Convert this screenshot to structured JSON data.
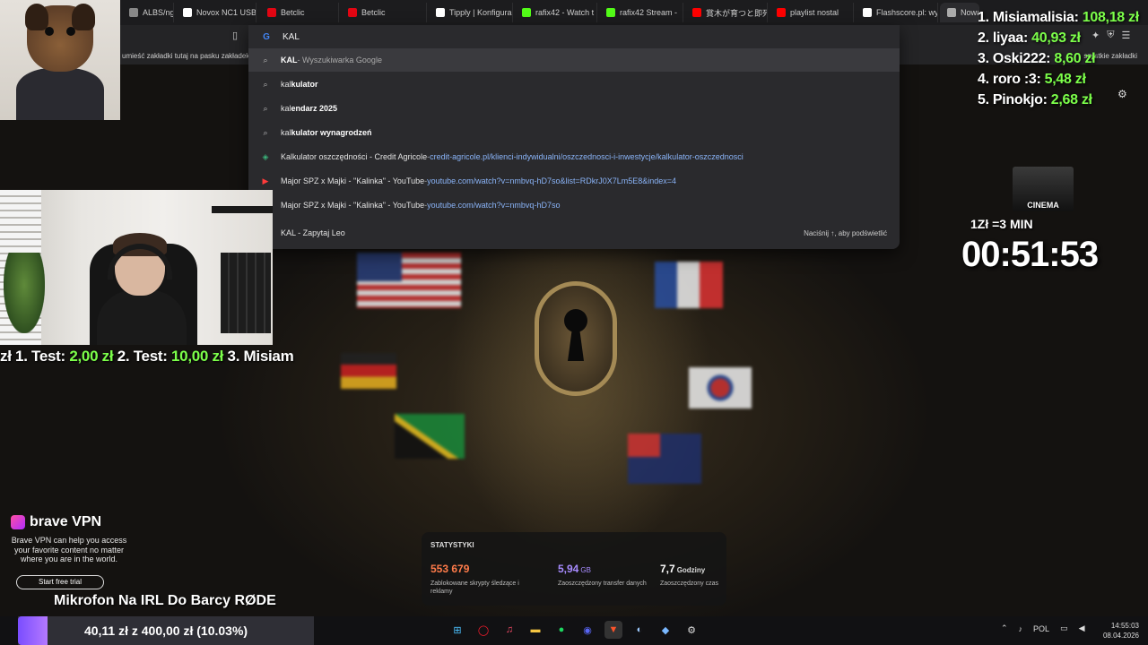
{
  "browser": {
    "tabs": [
      {
        "label": "ALBS/nginx-c",
        "color": "#888888"
      },
      {
        "label": "Novox NC1 USB",
        "color": "#ffffff"
      },
      {
        "label": "Betclic",
        "color": "#e30613"
      },
      {
        "label": "Betclic",
        "color": "#e30613"
      },
      {
        "label": "Tipply | Konfigura",
        "color": "#ffffff"
      },
      {
        "label": "rafix42 - Watch t",
        "color": "#53fc18"
      },
      {
        "label": "rafix42 Stream -",
        "color": "#53fc18"
      },
      {
        "label": "賞木が育つと即死",
        "color": "#ff0000"
      },
      {
        "label": "playlist nostal",
        "color": "#ff0000"
      },
      {
        "label": "Flashscore.pl: wyn",
        "color": "#ffffff"
      },
      {
        "label": "Nowa karta",
        "color": "#aaaaaa"
      }
    ],
    "address_value": "KAL",
    "bookmarks_hint": "umieść zakładki tutaj na pasku zakładek",
    "bookmarks_right": "szystkie zakładki"
  },
  "omnibox": {
    "suggestions": [
      {
        "icon": "search-icon",
        "bold": "KAL",
        "rest": " - Wyszukiwarka Google",
        "url": "",
        "dim": true
      },
      {
        "icon": "search-icon",
        "bold": "",
        "pre": "kal",
        "rest": "kulator",
        "url": ""
      },
      {
        "icon": "search-icon",
        "pre": "kal",
        "rest": "endarz 2025",
        "url": ""
      },
      {
        "icon": "search-icon",
        "pre": "kal",
        "rest": "kulator wynagrodzeń",
        "url": ""
      },
      {
        "icon": "site-icon",
        "title": "Kalkulator oszczędności - Credit Agricole",
        "url": "credit-agricole.pl/klienci-indywidualni/oszczednosci-i-inwestycje/kalkulator-oszczednosci"
      },
      {
        "icon": "youtube-icon",
        "title": "Major SPZ x Majki - \"Kalinka\" - YouTube",
        "url": "youtube.com/watch?v=nmbvq-hD7so&list=RDkrJ0X7Lm5E8&index=4"
      },
      {
        "icon": "youtube-icon",
        "title": "Major SPZ x Majki - \"Kalinka\" - YouTube",
        "url": "youtube.com/watch?v=nmbvq-hD7so"
      },
      {
        "icon": "leo-icon",
        "title": "KAL - Zapytaj Leo",
        "url": ""
      }
    ],
    "hint": "Naciśnij ↑, aby podświetlić"
  },
  "ticker": {
    "items": [
      {
        "name": "zł 1. Test:",
        "amount": "2,00 zł"
      },
      {
        "name": "2. Test:",
        "amount": "10,00 zł"
      },
      {
        "name": "3. Misiam",
        "amount": ""
      }
    ]
  },
  "leaderboard": [
    {
      "name": "1. Misiamalisia:",
      "amount": "108,18 zł"
    },
    {
      "name": "2. liyaa:",
      "amount": "40,93 zł"
    },
    {
      "name": "3. Oski222:",
      "amount": "8,60 zł"
    },
    {
      "name": "4. roro :3:",
      "amount": "5,48 zł"
    },
    {
      "name": "5. Pinokjo:",
      "amount": "2,68 zł"
    }
  ],
  "cinema": "CINEMA",
  "rate_text": "1Zł =3 MIN",
  "timer": "00:51:53",
  "vpn": {
    "title": "brave VPN",
    "text": "Brave VPN can help you access your favorite content no matter where you are in the world.",
    "button": "Start free trial"
  },
  "goal": {
    "title": "Mikrofon Na IRL Do Barcy RØDE",
    "progress_text": "40,11 zł z 400,00 zł (10.03%)",
    "progress": 0.1003
  },
  "stats": {
    "title": "STATYSTYKI",
    "items": [
      {
        "value": "553 679",
        "unit": "",
        "label": "Zablokowane skrypty śledzące i reklamy",
        "color": "#ff7b4a"
      },
      {
        "value": "5,94",
        "unit": "GB",
        "label": "Zaoszczędzony transfer danych",
        "color": "#a78bff"
      },
      {
        "value": "7,7",
        "unit": "Godziny",
        "label": "Zaoszczędzony czas",
        "color": "#ffffff"
      }
    ]
  },
  "taskbar": {
    "lang": "POL",
    "time": "14:55:03",
    "date": "08.04.2026"
  }
}
